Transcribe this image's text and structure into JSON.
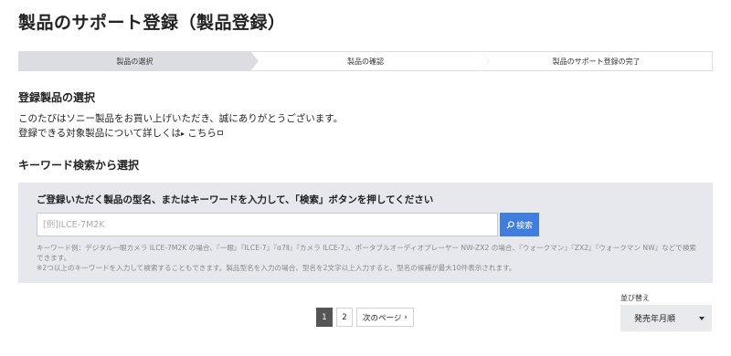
{
  "page": {
    "title": "製品のサポート登録（製品登録）"
  },
  "steps": [
    {
      "label": "製品の選択",
      "active": true
    },
    {
      "label": "製品の確認",
      "active": false
    },
    {
      "label": "製品のサポート登録の完了",
      "active": false
    }
  ],
  "select_section": {
    "title": "登録製品の選択",
    "line1": "このたびはソニー製品をお買い上げいただき、誠にありがとうございます。",
    "line2": "登録できる対象製品について詳しくは",
    "link_label": "こちら"
  },
  "keyword_section": {
    "title": "キーワード検索から選択",
    "heading": "ご登録いただく製品の型名、またはキーワードを入力して、「検索」ボタンを押してください",
    "input_placeholder": "[例]ILCE-7M2K",
    "input_value": "",
    "search_label": "検索",
    "note1": "キーワード例：デジタル一眼カメラ ILCE-7M2K の場合、『一眼』『ILCE-7』『α7Ⅱ』『カメラ ILCE-7』、ポータブルオーディオプレーヤー NW-ZX2 の場合、『ウォークマン』『ZX2』『ウォークマン NW』などで検索できます。",
    "note2": "※2つ以上のキーワードを入力して検索することもできます。製品型名を入力の場合、型名を2文字以上入力すると、型名の候補が最大10件表示されます。"
  },
  "pagination": {
    "pages": [
      "1",
      "2"
    ],
    "current": "1",
    "next_label": "次のページ"
  },
  "sort": {
    "label": "並び替え",
    "selected": "発売年月順"
  },
  "colors": {
    "accent": "#3f7ede",
    "panel": "#e6e8ed",
    "active_step": "#dcdde2"
  }
}
